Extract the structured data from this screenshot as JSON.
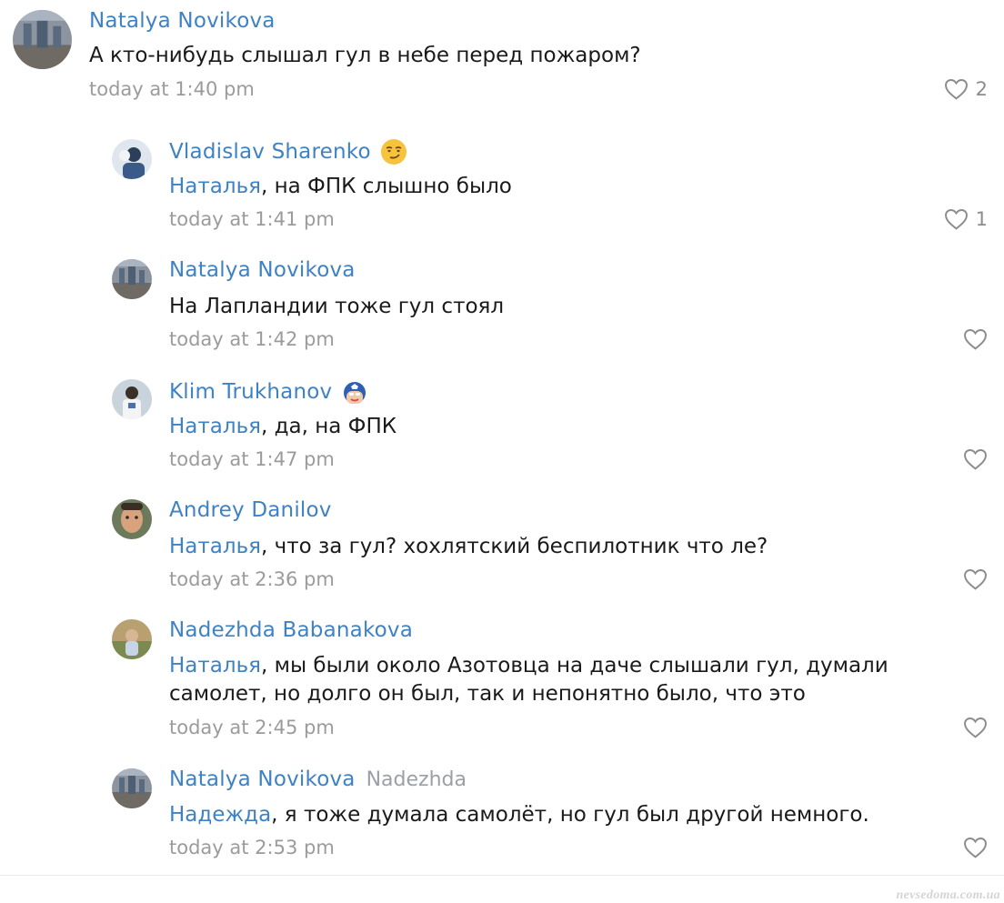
{
  "colors": {
    "link": "#3f82c4",
    "text": "#1a1a1a",
    "time": "#9b9b9b",
    "icon": "#8c8c8c"
  },
  "comments": [
    {
      "author": "Natalya Novikova",
      "reply_to": "",
      "mention": "",
      "text": "А кто-нибудь слышал гул в небе перед пожаром?",
      "time": "today at 1:40 pm",
      "likes": "2",
      "avatar_icon": "photo-avatar"
    },
    {
      "author": "Vladislav Sharenko",
      "emoji_icon": "smirking-face-emoji",
      "reply_to": "",
      "mention": "Наталья",
      "text": ", на ФПК слышно было",
      "time": "today at 1:41 pm",
      "likes": "1",
      "avatar_icon": "photo-avatar"
    },
    {
      "author": "Natalya Novikova",
      "reply_to": "",
      "mention": "",
      "text": "На Лапландии тоже гул стоял",
      "time": "today at 1:42 pm",
      "likes": "",
      "avatar_icon": "photo-avatar"
    },
    {
      "author": "Klim Trukhanov",
      "emoji_icon": "captain-america-emoji",
      "reply_to": "",
      "mention": "Наталья",
      "text": ", да, на ФПК",
      "time": "today at 1:47 pm",
      "likes": "",
      "avatar_icon": "photo-avatar"
    },
    {
      "author": "Andrey Danilov",
      "reply_to": "",
      "mention": "Наталья",
      "text": ", что за гул? хохлятский беспилотник что ле?",
      "time": "today at 2:36 pm",
      "likes": "",
      "avatar_icon": "photo-avatar"
    },
    {
      "author": "Nadezhda Babanakova",
      "reply_to": "",
      "mention": "Наталья",
      "text": ", мы были около Азотовца на даче слышали гул, думали самолет, но долго он был, так и непонятно было, что это",
      "time": "today at 2:45 pm",
      "likes": "",
      "avatar_icon": "photo-avatar"
    },
    {
      "author": "Natalya Novikova",
      "reply_to": "Nadezhda",
      "mention": "Надежда",
      "text": ", я тоже думала самолёт, но гул был другой немного.",
      "time": "today at 2:53 pm",
      "likes": "",
      "avatar_icon": "photo-avatar"
    }
  ],
  "watermark": "nevsedoma.com.ua"
}
